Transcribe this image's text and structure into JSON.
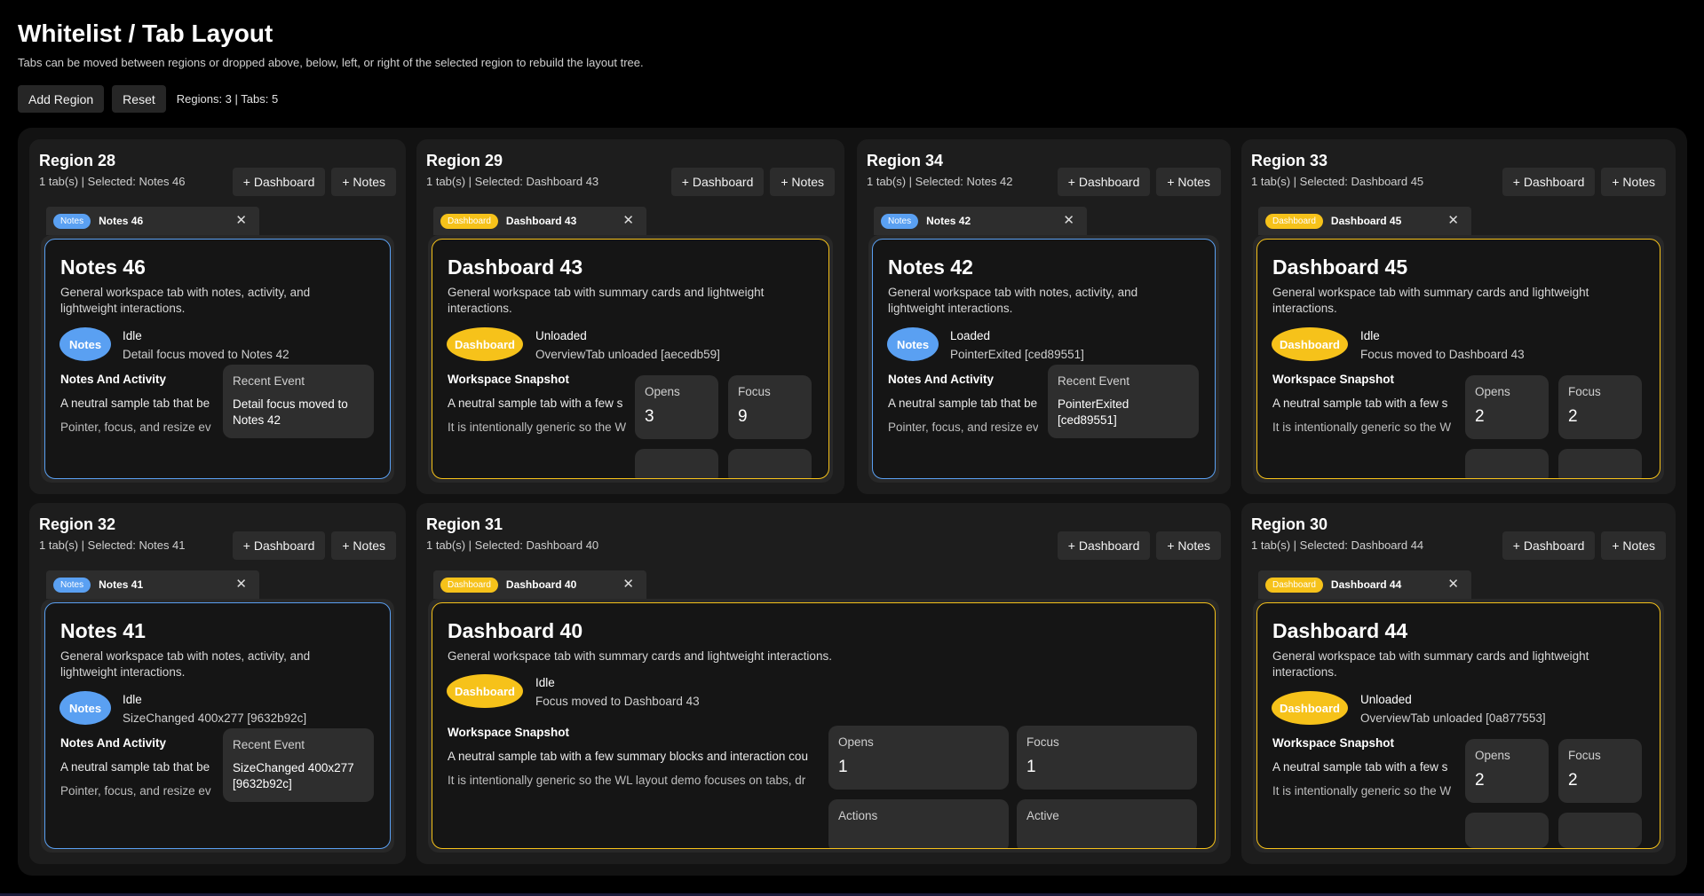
{
  "page": {
    "title": "Whitelist / Tab Layout",
    "subtitle": "Tabs can be moved between regions or dropped above, below, left, or right of the selected region to rebuild the layout tree.",
    "add_region_label": "Add Region",
    "reset_label": "Reset",
    "counts": "Regions: 3 | Tabs: 5"
  },
  "common": {
    "add_dashboard": "+ Dashboard",
    "add_notes": "+ Notes",
    "close_glyph": "✕",
    "recent_event": "Recent Event",
    "notes_desc_1": "General workspace tab with notes, activity, and",
    "notes_desc_2": "lightweight interactions.",
    "dash_desc_1": "General workspace tab with summary cards and lightweight",
    "dash_desc_2": "interactions.",
    "notes_section": "Notes And Activity",
    "dash_section": "Workspace Snapshot",
    "notes_line_1": "A neutral sample tab that be",
    "notes_line_2": "Pointer, focus, and resize ev",
    "dash_line_1": "A neutral sample tab with a few s",
    "dash_line_2": "It is intentionally generic so the W",
    "opens": "Opens",
    "focus": "Focus",
    "actions": "Actions",
    "active": "Active",
    "notes_kind": "Notes",
    "dashboard_kind": "Dashboard"
  },
  "regions": [
    {
      "title": "Region 28",
      "subtitle": "1 tab(s) | Selected: Notes 46",
      "tab_kind": "notes",
      "tab_label": "Notes 46",
      "card_title": "Notes 46",
      "status": "Idle",
      "message": "Detail focus moved to Notes 42",
      "event_text": "Detail focus moved to\nNotes 42"
    },
    {
      "title": "Region 29",
      "subtitle": "1 tab(s) | Selected: Dashboard 43",
      "tab_kind": "dashboard",
      "tab_label": "Dashboard 43",
      "card_title": "Dashboard 43",
      "status": "Unloaded",
      "message": "OverviewTab unloaded [aecedb59]",
      "opens": "3",
      "focus": "9"
    },
    {
      "title": "Region 34",
      "subtitle": "1 tab(s) | Selected: Notes 42",
      "tab_kind": "notes",
      "tab_label": "Notes 42",
      "card_title": "Notes 42",
      "status": "Loaded",
      "message": "PointerExited [ced89551]",
      "event_text": "PointerExited\n[ced89551]"
    },
    {
      "title": "Region 33",
      "subtitle": "1 tab(s) | Selected: Dashboard 45",
      "tab_kind": "dashboard",
      "tab_label": "Dashboard 45",
      "card_title": "Dashboard 45",
      "status": "Idle",
      "message": "Focus moved to Dashboard 43",
      "opens": "2",
      "focus": "2"
    },
    {
      "title": "Region 32",
      "subtitle": "1 tab(s) | Selected: Notes 41",
      "tab_kind": "notes",
      "tab_label": "Notes 41",
      "card_title": "Notes 41",
      "status": "Idle",
      "message": "SizeChanged 400x277 [9632b92c]",
      "event_text": "SizeChanged 400x277\n[9632b92c]"
    },
    {
      "title": "Region 31",
      "subtitle": "1 tab(s) | Selected: Dashboard 40",
      "tab_kind": "dashboard",
      "tab_label": "Dashboard 40",
      "card_title": "Dashboard 40",
      "status": "Idle",
      "message": "Focus moved to Dashboard 43",
      "desc_full": "General workspace tab with summary cards and lightweight interactions.",
      "line_1": "A neutral sample tab with a few summary blocks and interaction cou",
      "line_2": "It is intentionally generic so the WL layout demo focuses on tabs, dr",
      "opens": "1",
      "focus": "1"
    },
    {
      "title": "Region 30",
      "subtitle": "1 tab(s) | Selected: Dashboard 44",
      "tab_kind": "dashboard",
      "tab_label": "Dashboard 44",
      "card_title": "Dashboard 44",
      "status": "Unloaded",
      "message": "OverviewTab unloaded [0a877553]",
      "opens": "2",
      "focus": "2"
    }
  ]
}
